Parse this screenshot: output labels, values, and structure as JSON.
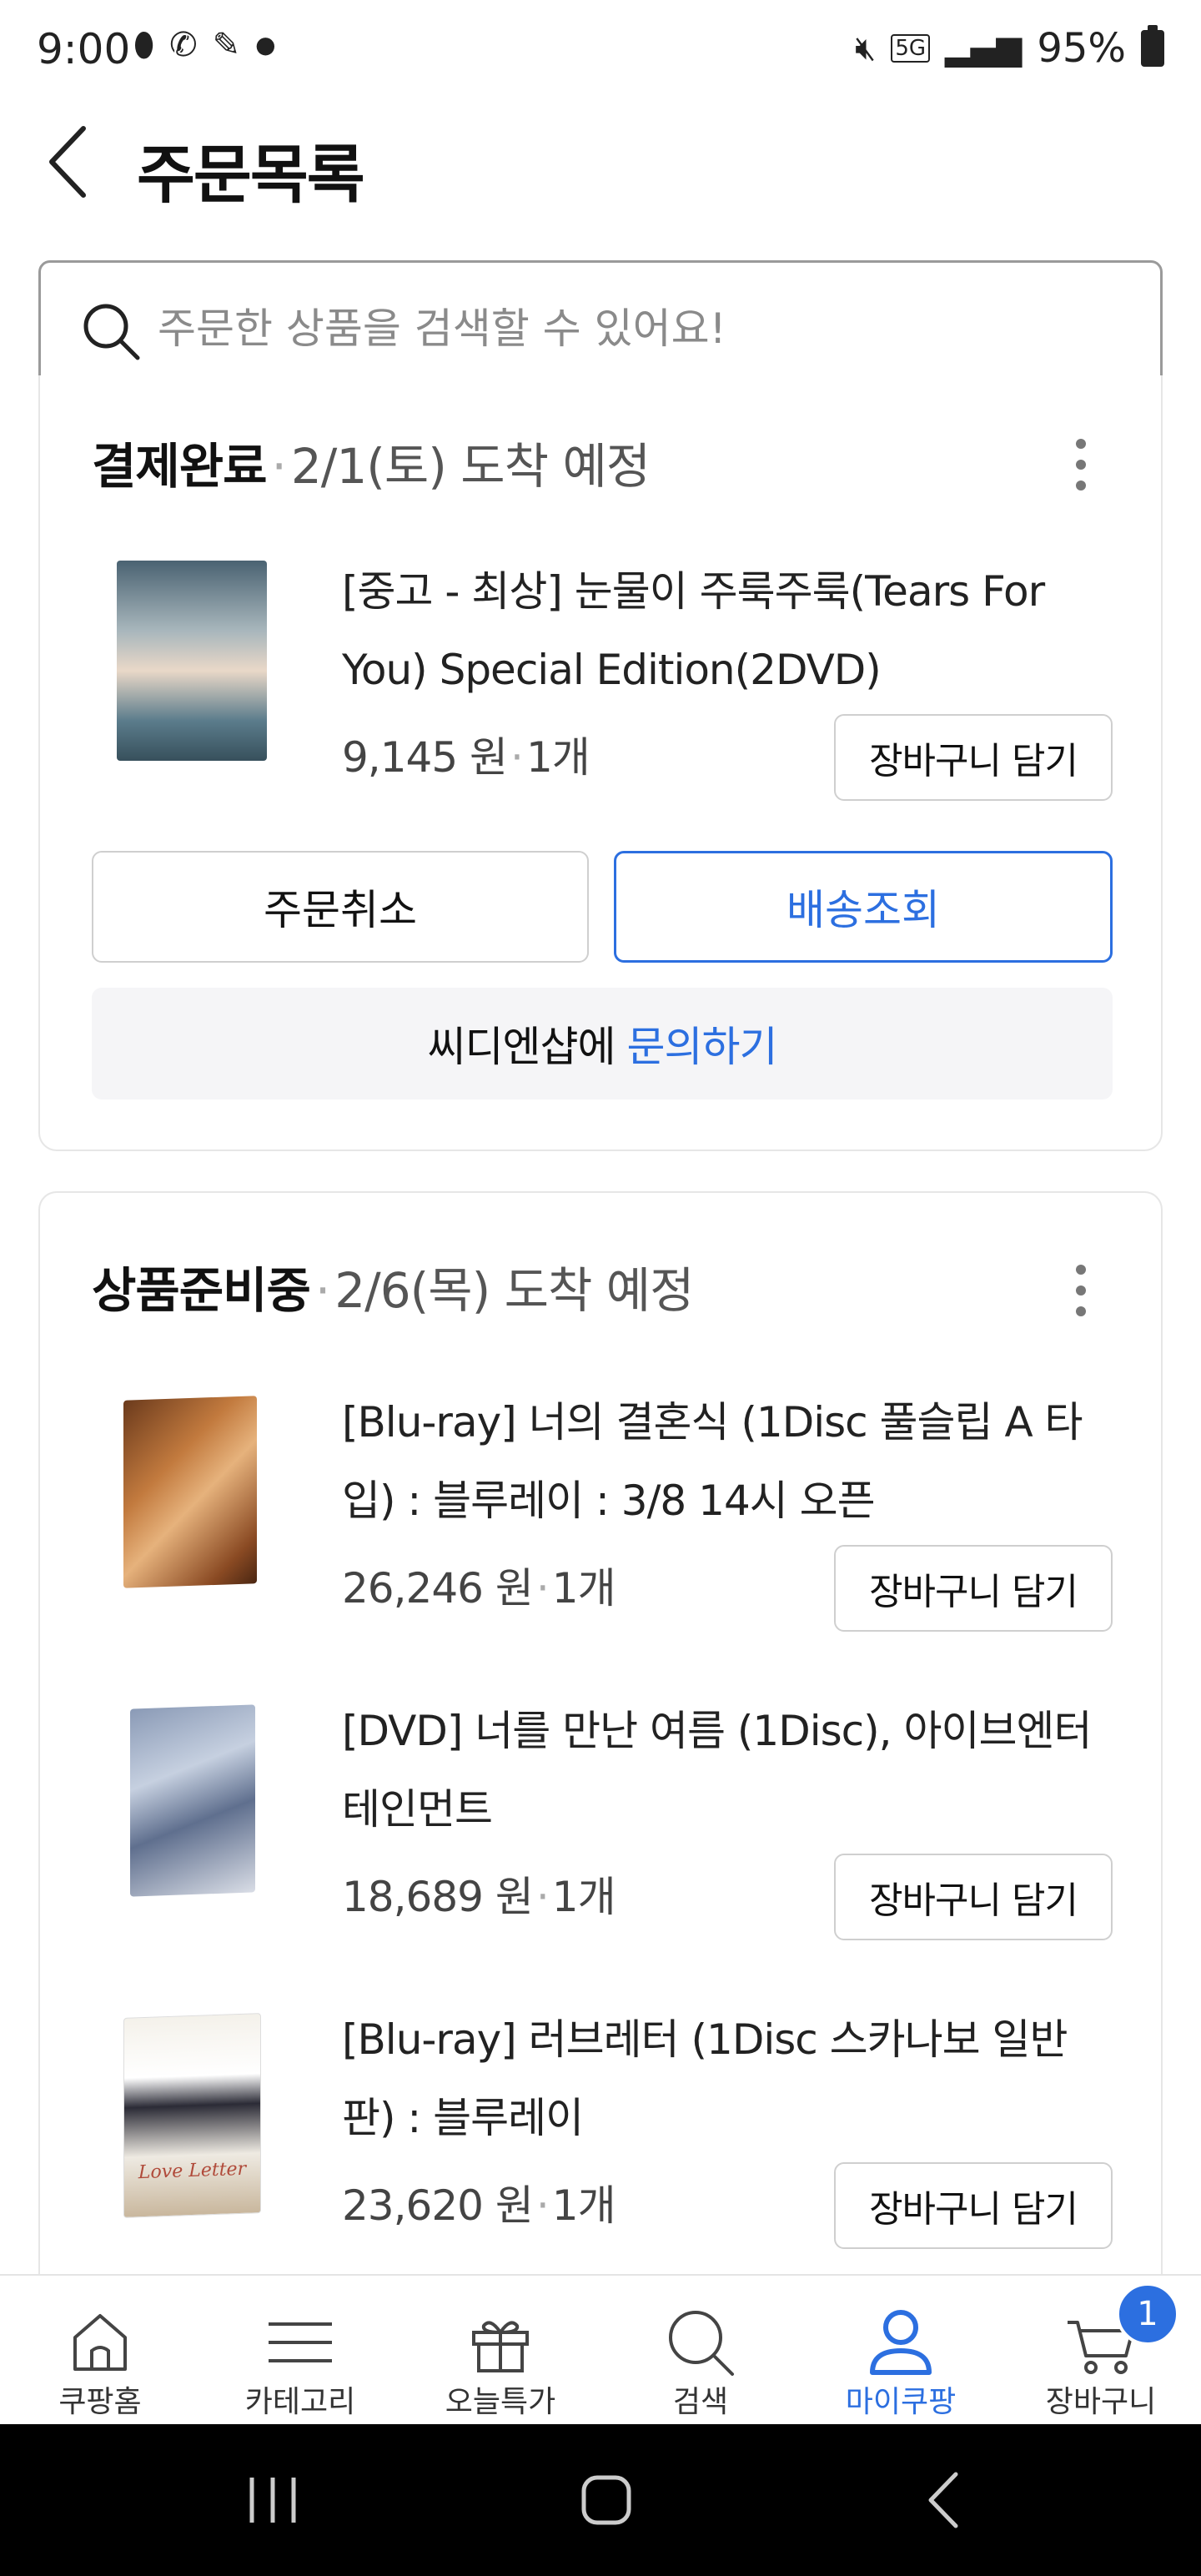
{
  "status_bar": {
    "time": "9:00",
    "left_icons": [
      "pill-icon",
      "phone-who-icon",
      "feather-icon",
      "dot-icon"
    ],
    "battery_percent": "95%",
    "network_label": "5G"
  },
  "header": {
    "title": "주문목록"
  },
  "search": {
    "placeholder": "주문한 상품을 검색할 수 있어요!"
  },
  "orders": [
    {
      "status": "결제완료",
      "date": "2/1(토) 도착 예정",
      "items": [
        {
          "title": "[중고 - 최상] 눈물이 주룩주룩(Tears For You) Special Edition(2DVD)",
          "price": "9,145 원",
          "qty": "1개",
          "cart_label": "장바구니 담기"
        }
      ],
      "cancel_label": "주문취소",
      "track_label": "배송조회",
      "seller": "씨디엔샵에",
      "inquiry_label": "문의하기"
    },
    {
      "status": "상품준비중",
      "date": "2/6(목) 도착 예정",
      "items": [
        {
          "title": "[Blu-ray] 너의 결혼식 (1Disc 풀슬립 A 타입) : 블루레이 : 3/8 14시 오픈",
          "price": "26,246 원",
          "qty": "1개",
          "cart_label": "장바구니 담기"
        },
        {
          "title": "[DVD] 너를 만난 여름 (1Disc), 아이브엔터테인먼트",
          "price": "18,689 원",
          "qty": "1개",
          "cart_label": "장바구니 담기"
        },
        {
          "title": "[Blu-ray] 러브레터 (1Disc 스카나보 일반판) : 블루레이",
          "price": "23,620 원",
          "qty": "1개",
          "cart_label": "장바구니 담기"
        }
      ]
    }
  ],
  "thumb_caption_loveletter": "Love Letter",
  "bottom_nav": [
    {
      "label": "쿠팡홈",
      "icon": "home-icon"
    },
    {
      "label": "카테고리",
      "icon": "menu-icon"
    },
    {
      "label": "오늘특가",
      "icon": "gift-icon"
    },
    {
      "label": "검색",
      "icon": "search-icon"
    },
    {
      "label": "마이쿠팡",
      "icon": "user-icon",
      "active": true
    },
    {
      "label": "장바구니",
      "icon": "cart-icon",
      "badge": "1"
    }
  ],
  "colors": {
    "accent": "#2c6fe0",
    "text": "#111111",
    "muted": "#555555",
    "border": "#cfcfcf"
  }
}
